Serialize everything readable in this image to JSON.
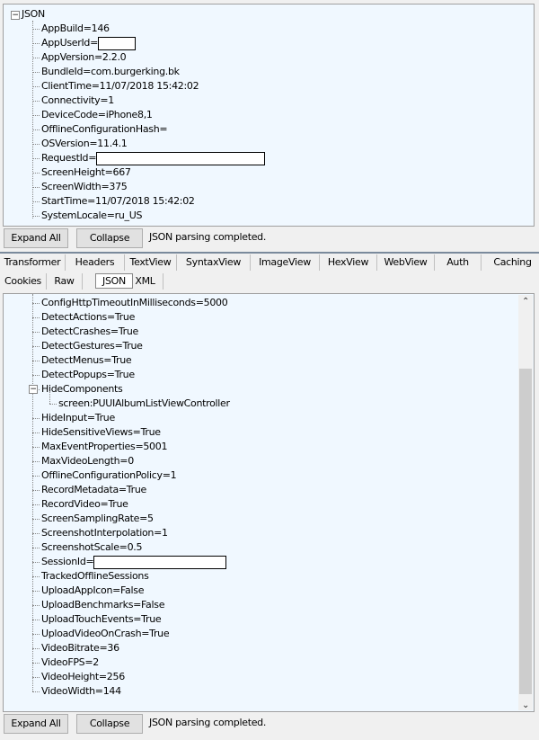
{
  "top_tree": {
    "root": "JSON",
    "items": [
      {
        "key": "AppBuild=146"
      },
      {
        "key": "AppUserId=",
        "redacted": true,
        "rw": 40
      },
      {
        "key": "AppVersion=2.2.0"
      },
      {
        "key": "BundleId=com.burgerking.bk"
      },
      {
        "key": "ClientTime=11/07/2018 15:42:02"
      },
      {
        "key": "Connectivity=1"
      },
      {
        "key": "DeviceCode=iPhone8,1"
      },
      {
        "key": "OfflineConfigurationHash="
      },
      {
        "key": "OSVersion=11.4.1"
      },
      {
        "key": "RequestId=",
        "redacted": true,
        "rw": 186
      },
      {
        "key": "ScreenHeight=667"
      },
      {
        "key": "ScreenWidth=375"
      },
      {
        "key": "StartTime=11/07/2018 15:42:02"
      },
      {
        "key": "SystemLocale=ru_US"
      }
    ]
  },
  "top_toolbar": {
    "expand_all": "Expand All",
    "collapse": "Collapse",
    "status": "JSON parsing completed."
  },
  "tabs_row1": [
    "Transformer",
    "Headers",
    "TextView",
    "SyntaxView",
    "ImageView",
    "HexView",
    "WebView",
    "Auth",
    "Caching"
  ],
  "tabs_row2": [
    "Cookies",
    "Raw",
    "JSON",
    "XML"
  ],
  "active_tab": "JSON",
  "bottom_tree": {
    "items": [
      {
        "key": "ConfigHttpTimeoutInMilliseconds=5000"
      },
      {
        "key": "DetectActions=True"
      },
      {
        "key": "DetectCrashes=True"
      },
      {
        "key": "DetectGestures=True"
      },
      {
        "key": "DetectMenus=True"
      },
      {
        "key": "DetectPopups=True"
      },
      {
        "key": "HideComponents",
        "expanded": true
      },
      {
        "key": "screen:PUUIAlbumListViewController",
        "child": true
      },
      {
        "key": "HideInput=True"
      },
      {
        "key": "HideSensitiveViews=True"
      },
      {
        "key": "MaxEventProperties=5001"
      },
      {
        "key": "MaxVideoLength=0"
      },
      {
        "key": "OfflineConfigurationPolicy=1"
      },
      {
        "key": "RecordMetadata=True"
      },
      {
        "key": "RecordVideo=True"
      },
      {
        "key": "ScreenSamplingRate=5"
      },
      {
        "key": "ScreenshotInterpolation=1"
      },
      {
        "key": "ScreenshotScale=0.5"
      },
      {
        "key": "SessionId=",
        "redacted": true,
        "rw": 146
      },
      {
        "key": "TrackedOfflineSessions"
      },
      {
        "key": "UploadAppIcon=False"
      },
      {
        "key": "UploadBenchmarks=False"
      },
      {
        "key": "UploadTouchEvents=True"
      },
      {
        "key": "UploadVideoOnCrash=True"
      },
      {
        "key": "VideoBitrate=36"
      },
      {
        "key": "VideoFPS=2"
      },
      {
        "key": "VideoHeight=256"
      },
      {
        "key": "VideoWidth=144"
      }
    ]
  },
  "bottom_toolbar": {
    "expand_all": "Expand All",
    "collapse": "Collapse",
    "status": "JSON parsing completed."
  },
  "colors": {
    "tree_bg": "#f0f8ff",
    "separator": "#7a8a9c"
  }
}
